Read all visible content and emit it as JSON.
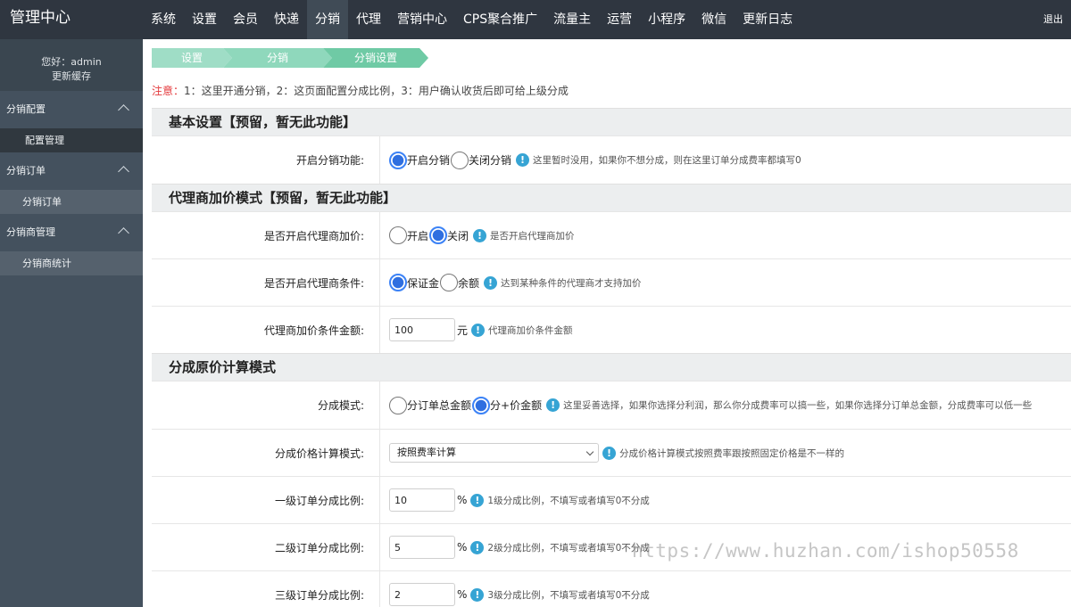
{
  "app": {
    "title": "管理中心",
    "logout": "退出"
  },
  "topnav": [
    {
      "label": "系统"
    },
    {
      "label": "设置"
    },
    {
      "label": "会员"
    },
    {
      "label": "快递"
    },
    {
      "label": "分销"
    },
    {
      "label": "代理"
    },
    {
      "label": "营销中心"
    },
    {
      "label": "CPS聚合推广"
    },
    {
      "label": "流量主"
    },
    {
      "label": "运营"
    },
    {
      "label": "小程序"
    },
    {
      "label": "微信"
    },
    {
      "label": "更新日志"
    }
  ],
  "topnav_active": "分销",
  "sidebar": {
    "greeting": "您好：admin",
    "refresh_cache": "更新缓存",
    "groups": [
      {
        "label": "分销配置",
        "items": [
          {
            "label": "配置管理",
            "active": true
          }
        ]
      },
      {
        "label": "分销订单",
        "items": [
          {
            "label": "分销订单"
          }
        ]
      },
      {
        "label": "分销商管理",
        "items": [
          {
            "label": "分销商统计"
          }
        ]
      }
    ]
  },
  "breadcrumb": [
    "设置",
    "分销",
    "分销设置"
  ],
  "notice": {
    "label": "注意：",
    "text": "1：这里开通分销，2：这页面配置分成比例，3：用户确认收货后即可给上级分成"
  },
  "sections": {
    "basic": {
      "title": "基本设置【预留，暂无此功能】",
      "enable": {
        "label": "开启分销功能:",
        "opt_on": "开启分销",
        "opt_off": "关闭分销",
        "selected": "开启分销",
        "tip": "这里暂时没用，如果你不想分成，则在这里订单分成费率都填写0"
      }
    },
    "agent": {
      "title": "代理商加价模式【预留，暂无此功能】",
      "enable": {
        "label": "是否开启代理商加价:",
        "opt_on": "开启",
        "opt_off": "关闭",
        "selected": "关闭",
        "tip": "是否开启代理商加价"
      },
      "condition": {
        "label": "是否开启代理商条件:",
        "opt_a": "保证金",
        "opt_b": "余额",
        "selected": "保证金",
        "tip": "达到某种条件的代理商才支持加价"
      },
      "amount": {
        "label": "代理商加价条件金额:",
        "value": "100",
        "unit": "元",
        "tip": "代理商加价条件金额"
      }
    },
    "commission": {
      "title": "分成原价计算模式",
      "mode": {
        "label": "分成模式:",
        "opt_a": "分订单总金额",
        "opt_b": "分+价金额",
        "selected": "分+价金额",
        "tip": "这里妥善选择，如果你选择分利润，那么你分成费率可以搞一些，如果你选择分订单总金额，分成费率可以低一些"
      },
      "calc": {
        "label": "分成价格计算模式:",
        "value": "按照费率计算",
        "tip": "分成价格计算模式按照费率跟按照固定价格是不一样的"
      },
      "level1": {
        "label": "一级订单分成比例:",
        "value": "10",
        "unit": "%",
        "tip": "1级分成比例，不填写或者填写0不分成"
      },
      "level2": {
        "label": "二级订单分成比例:",
        "value": "5",
        "unit": "%",
        "tip": "2级分成比例，不填写或者填写0不分成"
      },
      "level3": {
        "label": "三级订单分成比例:",
        "value": "2",
        "unit": "%",
        "tip": "3级分成比例，不填写或者填写0不分成"
      }
    }
  },
  "watermark": "https://www.huzhan.com/ishop50558",
  "colors": {
    "topbar": "#2f3640",
    "sidebar": "#44515e",
    "accent": "#3b82f6",
    "tip": "#36a4d4",
    "notice": "#e4393c",
    "crumb": "#6fcaa5"
  }
}
